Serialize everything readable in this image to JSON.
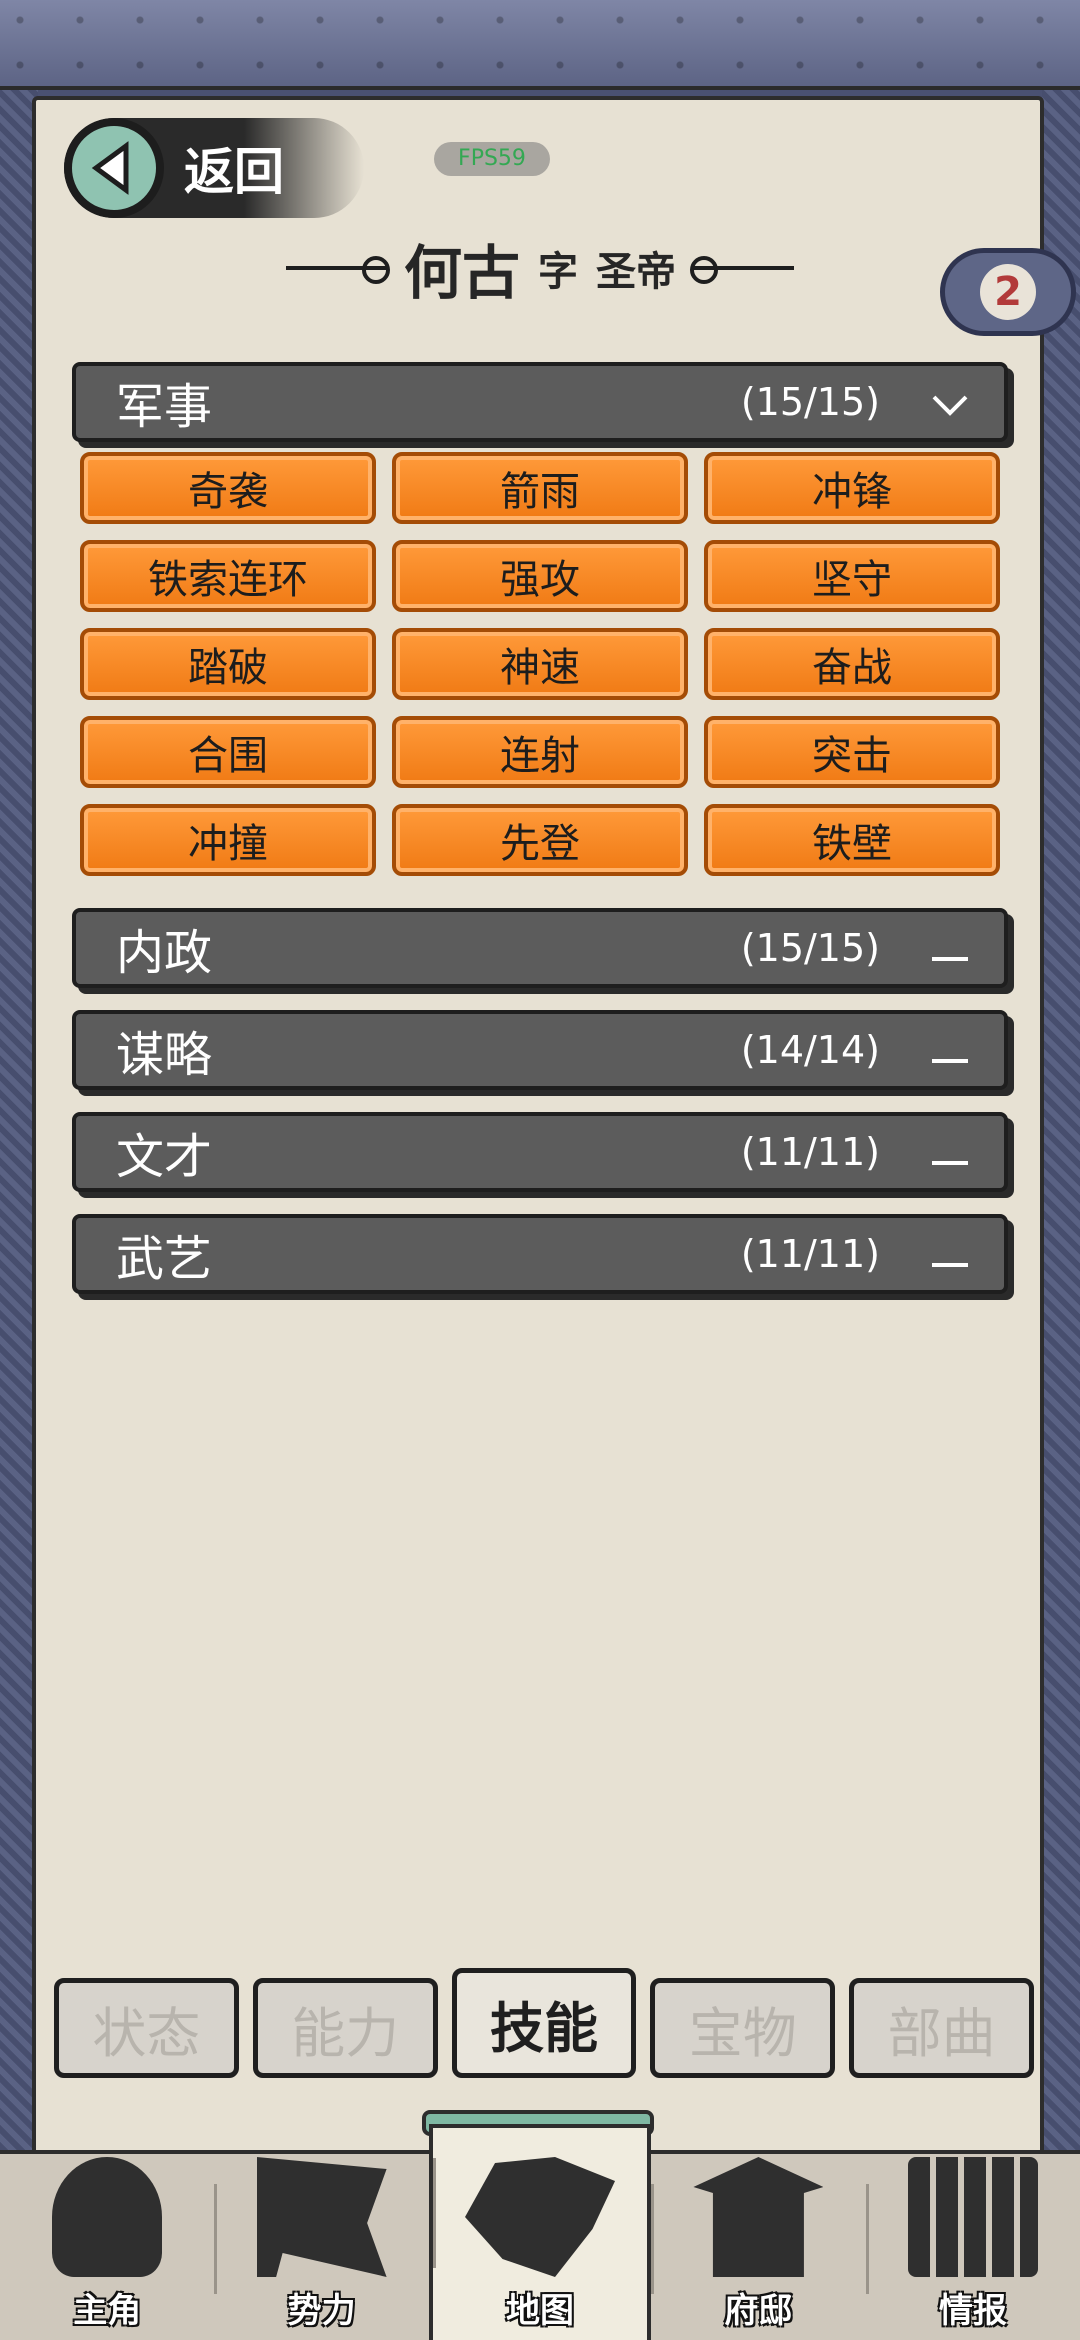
{
  "header": {
    "back_label": "返回",
    "fps": "FPS59",
    "character_name": "何古",
    "courtesy_prefix": "字",
    "courtesy_name": "圣帝",
    "points_badge": "2"
  },
  "categories": [
    {
      "name": "军事",
      "count": "(15/15)",
      "expanded": true,
      "skills": [
        "奇袭",
        "箭雨",
        "冲锋",
        "铁索连环",
        "强攻",
        "坚守",
        "踏破",
        "神速",
        "奋战",
        "合围",
        "连射",
        "突击",
        "冲撞",
        "先登",
        "铁壁"
      ]
    },
    {
      "name": "内政",
      "count": "(15/15)",
      "expanded": false
    },
    {
      "name": "谋略",
      "count": "(14/14)",
      "expanded": false
    },
    {
      "name": "文才",
      "count": "(11/11)",
      "expanded": false
    },
    {
      "name": "武艺",
      "count": "(11/11)",
      "expanded": false
    }
  ],
  "detail_tabs": [
    "状态",
    "能力",
    "技能",
    "宝物",
    "部曲"
  ],
  "active_detail_tab": "技能",
  "bottom_nav": [
    {
      "label": "主角",
      "icon": "avatar-icon"
    },
    {
      "label": "势力",
      "icon": "flag-icon"
    },
    {
      "label": "地图",
      "icon": "map-icon"
    },
    {
      "label": "府邸",
      "icon": "mansion-icon"
    },
    {
      "label": "情报",
      "icon": "scroll-icon"
    }
  ],
  "active_nav": "地图",
  "colors": {
    "skill_button": "#f5861f",
    "category_bar": "#5c5c5c",
    "paper": "#e7e1d3",
    "frame": "#4a5172"
  }
}
